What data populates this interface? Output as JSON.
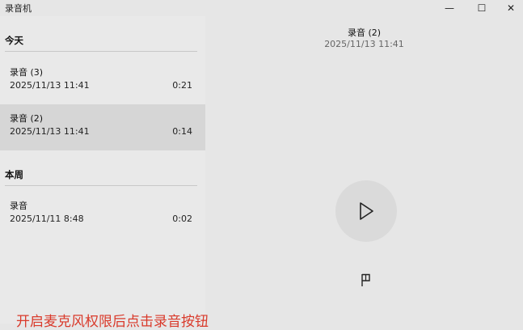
{
  "app": {
    "title": "录音机"
  },
  "window_controls": {
    "minimize": "—",
    "maximize": "☐",
    "close": "✕"
  },
  "sidebar": {
    "groups": [
      {
        "header": "今天",
        "items": [
          {
            "name": "录音 (3)",
            "date": "2025/11/13 11:41",
            "duration": "0:21"
          },
          {
            "name": "录音 (2)",
            "date": "2025/11/13 11:41",
            "duration": "0:14",
            "selected": true
          }
        ]
      },
      {
        "header": "本周",
        "items": [
          {
            "name": "录音",
            "date": "2025/11/11 8:48",
            "duration": "0:02"
          }
        ]
      }
    ]
  },
  "player": {
    "title": "录音 (2)",
    "date": "2025/11/13 11:41",
    "play_icon": "play-icon",
    "flag_icon": "flag-icon"
  },
  "caption": {
    "text": "开启麦克风权限后点击录音按钮"
  }
}
